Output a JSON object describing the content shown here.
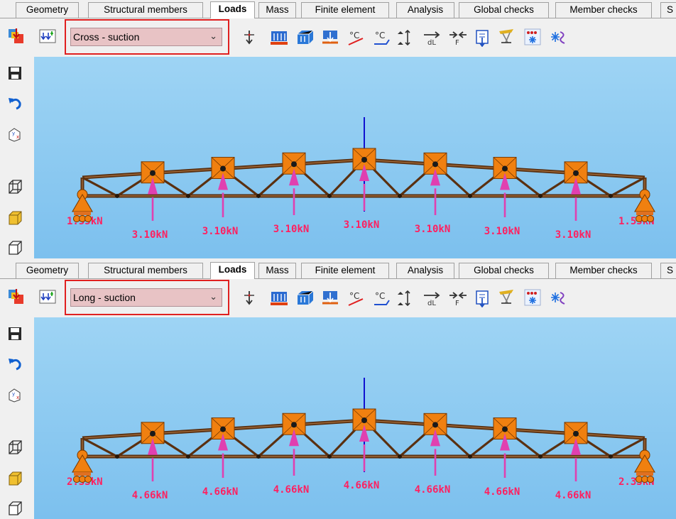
{
  "tabs": [
    "Geometry",
    "Structural members",
    "Loads",
    "Mass",
    "Finite element",
    "Analysis",
    "Global checks",
    "Member checks",
    "S"
  ],
  "active_tab": "Loads",
  "panels": [
    {
      "load_case": "Cross - suction",
      "point_loads": [
        "3.10kN",
        "3.10kN",
        "3.10kN",
        "3.10kN",
        "3.10kN",
        "3.10kN",
        "3.10kN"
      ],
      "reaction_left": "1.55kN",
      "reaction_right": "1.55kN"
    },
    {
      "load_case": "Long - suction",
      "point_loads": [
        "4.66kN",
        "4.66kN",
        "4.66kN",
        "4.66kN",
        "4.66kN",
        "4.66kN",
        "4.66kN"
      ],
      "reaction_left": "2.33kN",
      "reaction_right": "2.33kN"
    }
  ],
  "colors": {
    "canvas_top": "#9ed4f4",
    "canvas_bottom": "#7cc0ee",
    "truss": "#5a3010",
    "load_arrow": "#e040b0",
    "load_label": "#ff2060",
    "node_box": "#f08010",
    "highlight": "#e02020",
    "combo_fill": "#e8c3c5"
  },
  "icons": {
    "toolbar": [
      "load-generate-icon",
      "load-combine-icon",
      "point-load-icon",
      "distributed-load-icon",
      "area-load-icon",
      "surface-load-icon",
      "temperature-load-icon",
      "temperature-gradient-icon",
      "settlement-icon",
      "length-change-icon",
      "prestress-icon",
      "selfweight-icon",
      "crane-load-icon",
      "snow-load-icon",
      "wind-snow-icon"
    ],
    "left": [
      "save-icon",
      "undo-icon",
      "axis-view-icon",
      "wireframe-icon",
      "solid-view-icon",
      "render-view-icon"
    ]
  }
}
